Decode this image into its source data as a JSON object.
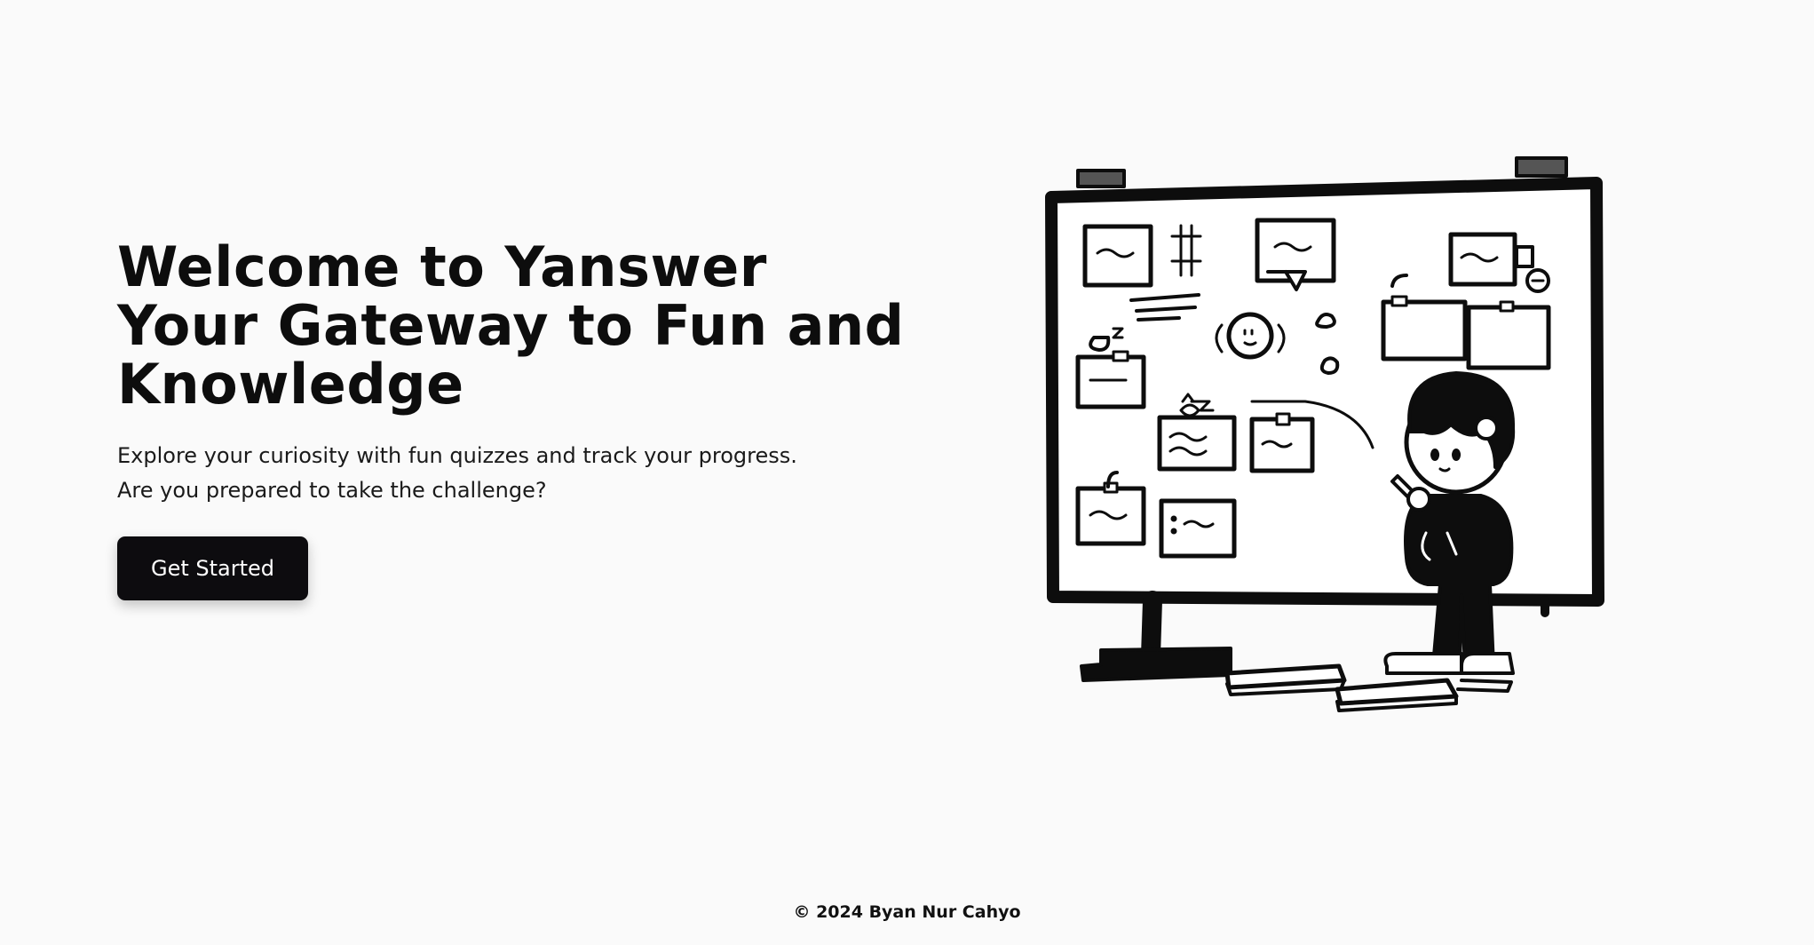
{
  "hero": {
    "title_line1": "Welcome to Yanswer",
    "title_line2": "Your Gateway to Fun and",
    "title_line3": "Knowledge",
    "description_line1": "Explore your curiosity with fun quizzes and track your progress.",
    "description_line2": "Are you prepared to take the challenge?",
    "cta_label": "Get Started"
  },
  "illustration": {
    "icon": "whiteboard-student-illustration"
  },
  "footer": {
    "copyright": "© 2024 Byan Nur Cahyo"
  },
  "colors": {
    "background": "#fafafa",
    "button": "#0d0c0f",
    "text": "#111111"
  }
}
